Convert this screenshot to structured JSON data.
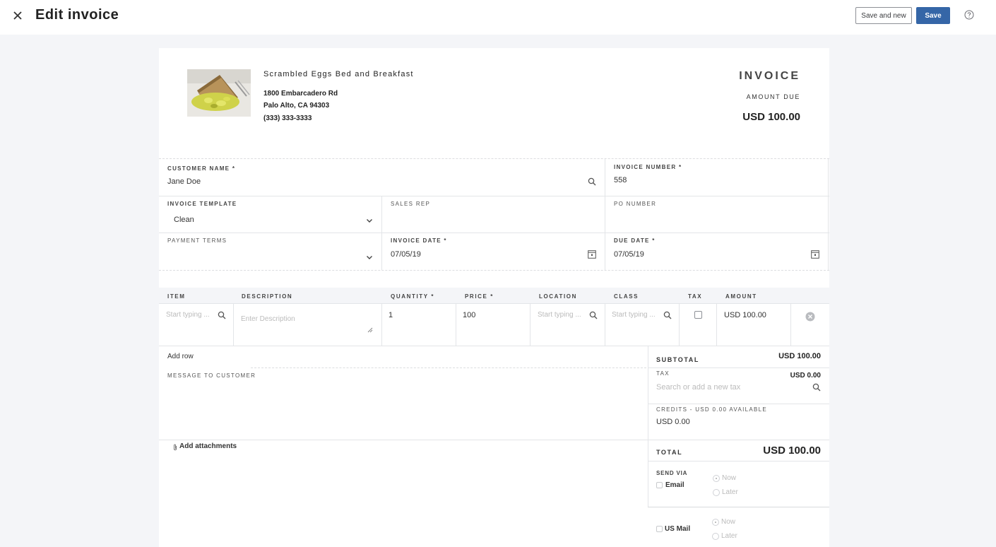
{
  "header": {
    "title": "Edit invoice",
    "save_and_new_label": "Save and new",
    "save_label": "Save"
  },
  "company": {
    "name": "Scrambled Eggs Bed and Breakfast",
    "address_line1": "1800 Embarcadero Rd",
    "address_line2": "Palo Alto, CA 94303",
    "phone": "(333) 333-3333"
  },
  "invoice_header": {
    "title": "INVOICE",
    "amount_due_label": "AMOUNT DUE",
    "amount_due_value": "USD 100.00"
  },
  "fields": {
    "customer_name_label": "CUSTOMER NAME *",
    "customer_name_value": "Jane Doe",
    "invoice_number_label": "INVOICE NUMBER *",
    "invoice_number_value": "558",
    "invoice_template_label": "INVOICE TEMPLATE",
    "invoice_template_value": "Clean",
    "sales_rep_label": "SALES REP",
    "sales_rep_value": "",
    "po_number_label": "PO NUMBER",
    "po_number_value": "",
    "payment_terms_label": "PAYMENT TERMS",
    "payment_terms_value": "",
    "invoice_date_label": "INVOICE DATE *",
    "invoice_date_value": "07/05/19",
    "due_date_label": "DUE DATE *",
    "due_date_value": "07/05/19"
  },
  "line_items": {
    "columns": [
      "ITEM",
      "DESCRIPTION",
      "QUANTITY *",
      "PRICE *",
      "LOCATION",
      "CLASS",
      "TAX",
      "AMOUNT"
    ],
    "rows": [
      {
        "item_placeholder": "Start typing ...",
        "description_placeholder": "Enter Description",
        "quantity": "1",
        "price": "100",
        "location_placeholder": "Start typing ...",
        "class_placeholder": "Start typing ...",
        "tax_checked": false,
        "amount": "USD 100.00"
      }
    ],
    "add_row_label": "Add row"
  },
  "message": {
    "label": "MESSAGE TO CUSTOMER",
    "value": ""
  },
  "attachments": {
    "label": "Add attachments"
  },
  "summary": {
    "subtotal_label": "SUBTOTAL",
    "subtotal_value": "USD 100.00",
    "tax_label": "TAX",
    "tax_value": "USD 0.00",
    "tax_search_placeholder": "Search or add a new tax",
    "credits_label": "CREDITS - USD 0.00 Available",
    "credits_value": "USD 0.00",
    "total_label": "TOTAL",
    "total_value": "USD 100.00"
  },
  "send_via": {
    "label": "SEND VIA",
    "email_label": "Email",
    "email_now": "Now",
    "email_later": "Later",
    "mail_label": "US Mail",
    "mail_now": "Now",
    "mail_later": "Later"
  },
  "colors": {
    "primary_button": "#3566a7",
    "page_background": "#f4f5f8"
  }
}
